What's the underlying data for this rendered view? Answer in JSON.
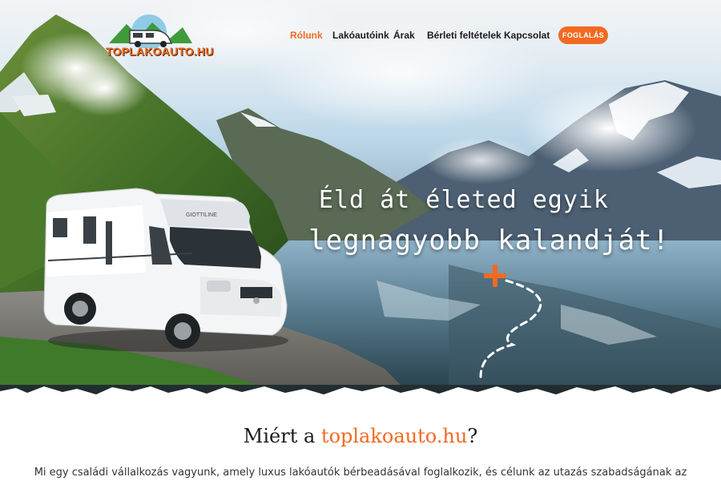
{
  "brand": {
    "name": "TOPLAKOAUTO.HU"
  },
  "nav": {
    "items": [
      {
        "label": "Rólunk",
        "active": true
      },
      {
        "label": "Lakóautóink",
        "active": false
      },
      {
        "label": "Árak",
        "active": false
      },
      {
        "label": "Bérleti feltételek",
        "active": false
      },
      {
        "label": "Kapcsolat",
        "active": false
      }
    ],
    "cta_label": "FOGLALÁS"
  },
  "hero": {
    "line1": "Éld át életed egyik",
    "line2": "legnagyobb kalandját!",
    "van_model": "GIOTTILINE"
  },
  "about": {
    "title_prefix": "Miért a ",
    "title_accent": "toplakoauto.hu",
    "title_suffix": "?",
    "intro": "Mi egy családi vállalkozás vagyunk, amely luxus lakóautók bérbeadásával foglalkozik, és célunk az utazás szabadságának az"
  },
  "colors": {
    "accent": "#f26a21",
    "text": "#1c1c1c",
    "background": "#ffffff"
  }
}
